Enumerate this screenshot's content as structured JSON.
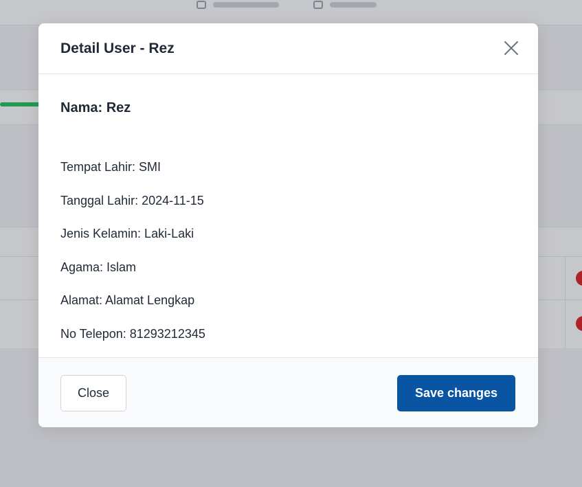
{
  "modal": {
    "title": "Detail User - Rez",
    "name_line": "Nama: Rez",
    "details": [
      "Tempat Lahir: SMI",
      "Tanggal Lahir: 2024-11-15",
      "Jenis Kelamin: Laki-Laki",
      "Agama: Islam",
      "Alamat: Alamat Lengkap",
      "No Telepon: 81293212345"
    ],
    "close_label": "Close",
    "save_label": "Save changes",
    "close_icon": "close-icon"
  },
  "colors": {
    "primary": "#0a54a4",
    "backdrop": "rgba(26,32,44,0.25)"
  }
}
